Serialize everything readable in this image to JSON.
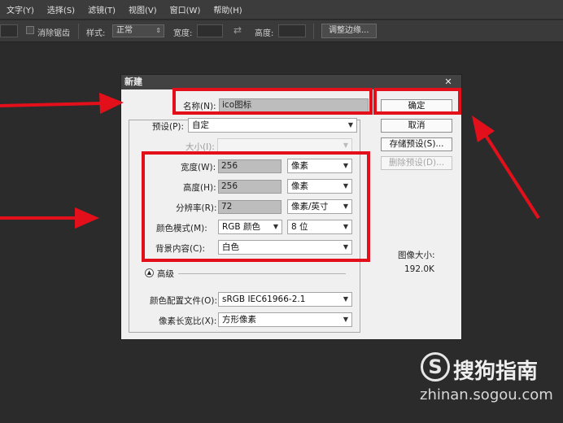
{
  "menubar": {
    "items": [
      "文字(Y)",
      "选择(S)",
      "滤镜(T)",
      "视图(V)",
      "窗口(W)",
      "帮助(H)"
    ]
  },
  "optionsbar": {
    "antialias_label": "消除锯齿",
    "style_label": "样式:",
    "style_value": "正常",
    "width_label": "宽度:",
    "height_label": "高度:",
    "refine_edge_button": "调整边缘..."
  },
  "dialog": {
    "title": "新建",
    "close": "✕",
    "name_label": "名称(N):",
    "name_value": "ico图标",
    "preset_label": "预设(P):",
    "preset_value": "自定",
    "size_label": "大小(I):",
    "width_label": "宽度(W):",
    "width_value": "256",
    "width_unit": "像素",
    "height_label": "高度(H):",
    "height_value": "256",
    "height_unit": "像素",
    "resolution_label": "分辨率(R):",
    "resolution_value": "72",
    "resolution_unit": "像素/英寸",
    "color_mode_label": "颜色模式(M):",
    "color_mode_value": "RGB 颜色",
    "bit_depth_value": "8 位",
    "background_label": "背景内容(C):",
    "background_value": "白色",
    "advanced_label": "高级",
    "color_profile_label": "颜色配置文件(O):",
    "color_profile_value": "sRGB IEC61966-2.1",
    "pixel_aspect_label": "像素长宽比(X):",
    "pixel_aspect_value": "方形像素",
    "buttons": {
      "ok": "确定",
      "cancel": "取消",
      "save_preset": "存储预设(S)...",
      "delete_preset": "删除预设(D)..."
    },
    "image_size_label": "图像大小:",
    "image_size_value": "192.0K"
  },
  "annotation_colors": {
    "red": "#e3101c"
  },
  "watermark": {
    "logo_letter": "S",
    "title": "搜狗指南",
    "url": "zhinan.sogou.com"
  }
}
